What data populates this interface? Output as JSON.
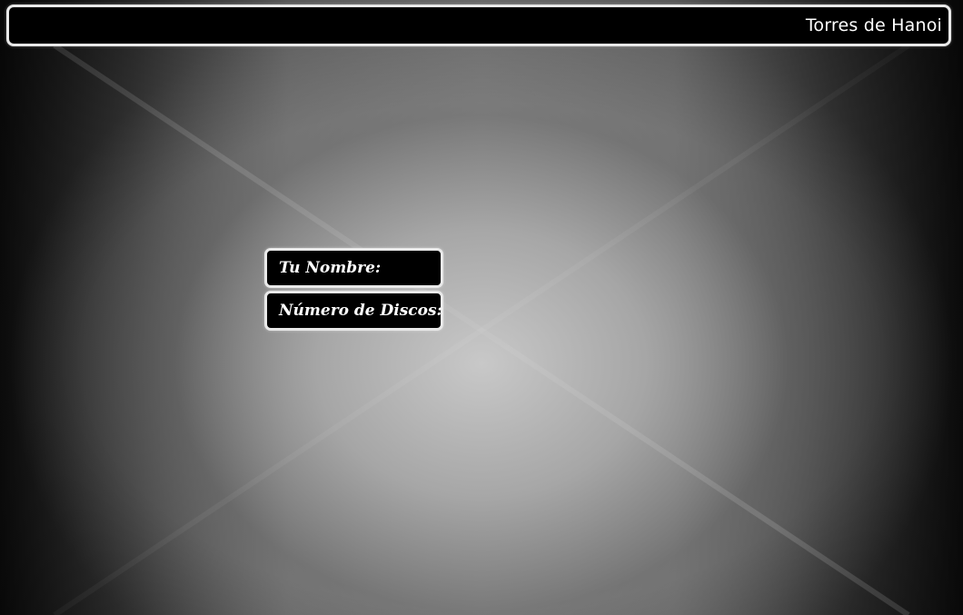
{
  "header": {
    "title": "Torres de Hanoi"
  },
  "form": {
    "name_label": "Tu Nombre:",
    "discs_label": "Número de Discos:"
  },
  "colors": {
    "panel_background": "#000000",
    "panel_border": "#e9e9e9",
    "text": "#ffffff",
    "background_center": "#c0c0c0",
    "background_edge": "#0c0c0c"
  }
}
